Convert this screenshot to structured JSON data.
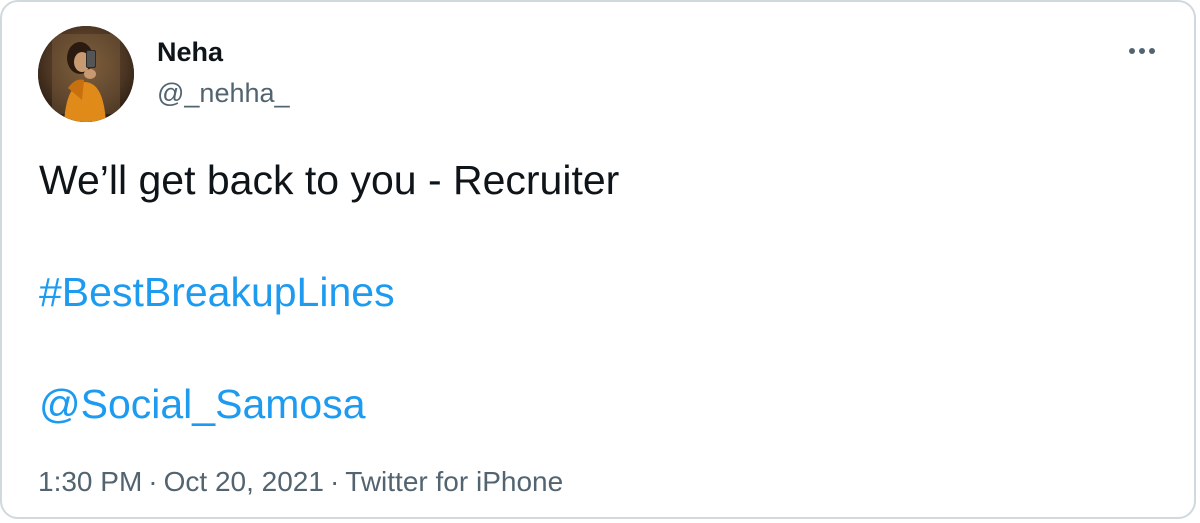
{
  "author": {
    "display_name": "Neha",
    "handle": "@_nehha_",
    "avatar_icon": "profile-photo"
  },
  "menu": {
    "more_icon": "ellipsis-horizontal-icon"
  },
  "tweet": {
    "text": "We’ll get back to you - Recruiter",
    "hashtag": "#BestBreakupLines",
    "mention": "@Social_Samosa"
  },
  "meta": {
    "time": "1:30 PM",
    "separator": "·",
    "date": "Oct 20, 2021",
    "source": "Twitter for iPhone"
  },
  "colors": {
    "link": "#1d9bf0",
    "text": "#0f1419",
    "secondary": "#536471",
    "border": "#cfd9de"
  }
}
